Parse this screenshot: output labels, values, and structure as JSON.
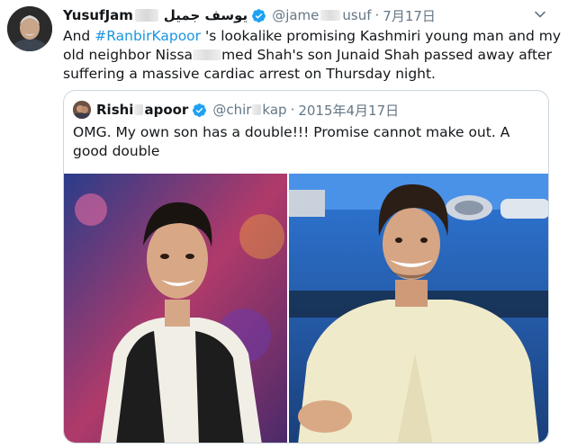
{
  "tweet": {
    "display_name": "YusufJam",
    "display_name_arabic": "يوسف جميل",
    "handle_prefix": "@jame",
    "handle_suffix": "usuf",
    "separator": "·",
    "date": "7月17日",
    "avatar_icon": "user-avatar",
    "caret_icon": "chevron-down-icon",
    "verified_icon": "verified-badge-icon",
    "verified_color": "#1da1f2",
    "text": {
      "part1": "And ",
      "hashtag": "#RanbirKapoor",
      "part2": " 's lookalike promising Kashmiri young man and my old neighbor Nissa",
      "part3": "med Shah's son Junaid Shah passed away after suffering a massive cardiac arrest on Thursday night."
    }
  },
  "quoted": {
    "display_name_start": "Rishi",
    "display_name_end": "apoor",
    "handle_start": "@chir",
    "handle_end": "kap",
    "separator": "·",
    "date": "2015年4月17日",
    "text": "OMG. My own son has a double!!! Promise cannot make out. A good double",
    "photos": [
      "photo-left",
      "photo-right"
    ]
  },
  "colors": {
    "link": "#1b95e0",
    "secondary_text": "#657786",
    "border": "#ccd6dd"
  }
}
